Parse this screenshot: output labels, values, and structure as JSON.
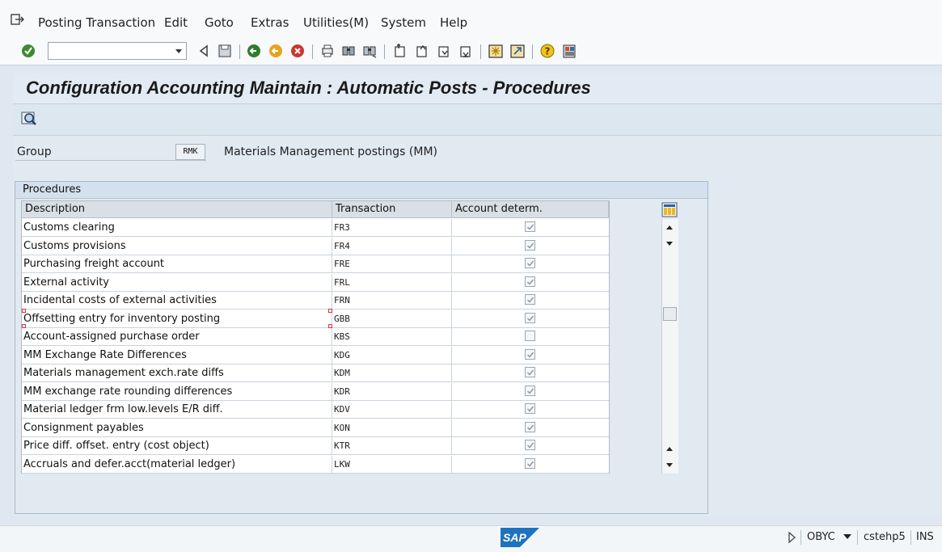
{
  "menu": {
    "items": [
      "Posting Transaction",
      "Edit",
      "Goto",
      "Extras",
      "Utilities(M)",
      "System",
      "Help"
    ]
  },
  "toolbar": {
    "command_field_value": "",
    "icons": [
      "enter-icon",
      "back-arrow-icon",
      "save-icon",
      "back-icon",
      "exit-icon",
      "cancel-icon",
      "print-icon",
      "find-icon",
      "find-next-icon",
      "first-page-icon",
      "previous-page-icon",
      "next-page-icon",
      "last-page-icon",
      "create-session-icon",
      "shortcut-icon",
      "help-icon",
      "customize-layout-icon"
    ]
  },
  "title": "Configuration Accounting Maintain : Automatic Posts - Procedures",
  "group": {
    "label": "Group",
    "value": "RMK",
    "description": "Materials Management postings (MM)"
  },
  "procedures": {
    "title": "Procedures",
    "columns": [
      "Description",
      "Transaction",
      "Account determ."
    ],
    "rows": [
      {
        "description": "Customs clearing",
        "transaction": "FR3",
        "account_determ": true
      },
      {
        "description": "Customs provisions",
        "transaction": "FR4",
        "account_determ": true
      },
      {
        "description": "Purchasing freight account",
        "transaction": "FRE",
        "account_determ": true
      },
      {
        "description": "External activity",
        "transaction": "FRL",
        "account_determ": true
      },
      {
        "description": "Incidental costs of external activities",
        "transaction": "FRN",
        "account_determ": true
      },
      {
        "description": "Offsetting entry for inventory posting",
        "transaction": "GBB",
        "account_determ": true
      },
      {
        "description": "Account-assigned purchase order",
        "transaction": "KBS",
        "account_determ": false
      },
      {
        "description": "MM Exchange Rate Differences",
        "transaction": "KDG",
        "account_determ": true
      },
      {
        "description": "Materials management exch.rate diffs",
        "transaction": "KDM",
        "account_determ": true
      },
      {
        "description": "MM exchange rate rounding differences",
        "transaction": "KDR",
        "account_determ": true
      },
      {
        "description": "Material ledger frm low.levels E/R diff.",
        "transaction": "KDV",
        "account_determ": true
      },
      {
        "description": "Consignment payables",
        "transaction": "KON",
        "account_determ": true
      },
      {
        "description": "Price diff. offset. entry (cost object)",
        "transaction": "KTR",
        "account_determ": true
      },
      {
        "description": "Accruals and defer.acct(material ledger)",
        "transaction": "LKW",
        "account_determ": true
      }
    ]
  },
  "status": {
    "logo": "SAP",
    "transaction": "OBYC",
    "server": "cstehp5",
    "mode": "INS"
  },
  "colors": {
    "background": "#dfe8f0",
    "header": "#d3e1ee",
    "enter_green": "#3b8a2e",
    "sap_blue": "#1e73be"
  }
}
